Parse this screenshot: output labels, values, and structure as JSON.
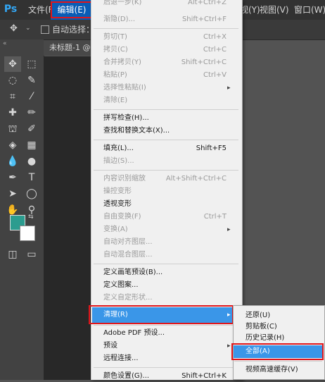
{
  "colors": {
    "accent": "#3a96e8",
    "highlight_border": "#e0161b",
    "menubar": "#323232",
    "foreground": "#2b9c8f",
    "background_color": "#ffffff"
  },
  "menubar": {
    "logo": "Ps",
    "items": [
      {
        "label": "文件(F)"
      },
      {
        "label": "编辑(E)"
      },
      {
        "label": "视(Y)"
      },
      {
        "label": "视图(V)"
      },
      {
        "label": "窗口(W)"
      }
    ]
  },
  "options_bar": {
    "auto_select": "自动选择："
  },
  "document": {
    "tab_title": "未标题-1 @"
  },
  "edit_menu": {
    "items": [
      {
        "label": "后退一步(K)",
        "shortcut": "Alt+Ctrl+Z",
        "enabled": false
      },
      {
        "label": "渐隐(D)...",
        "shortcut": "Shift+Ctrl+F",
        "enabled": false
      },
      {
        "label": "剪切(T)",
        "shortcut": "Ctrl+X",
        "enabled": false
      },
      {
        "label": "拷贝(C)",
        "shortcut": "Ctrl+C",
        "enabled": false
      },
      {
        "label": "合并拷贝(Y)",
        "shortcut": "Shift+Ctrl+C",
        "enabled": false
      },
      {
        "label": "粘贴(P)",
        "shortcut": "Ctrl+V",
        "enabled": false
      },
      {
        "label": "选择性粘贴(I)",
        "shortcut": "",
        "enabled": false,
        "submenu": true
      },
      {
        "label": "清除(E)",
        "shortcut": "",
        "enabled": false
      },
      {
        "label": "拼写检查(H)...",
        "shortcut": "",
        "enabled": true
      },
      {
        "label": "查找和替换文本(X)...",
        "shortcut": "",
        "enabled": true
      },
      {
        "label": "填充(L)...",
        "shortcut": "Shift+F5",
        "enabled": true
      },
      {
        "label": "描边(S)...",
        "shortcut": "",
        "enabled": false
      },
      {
        "label": "内容识别缩放",
        "shortcut": "Alt+Shift+Ctrl+C",
        "enabled": false
      },
      {
        "label": "操控变形",
        "shortcut": "",
        "enabled": false
      },
      {
        "label": "透视变形",
        "shortcut": "",
        "enabled": true
      },
      {
        "label": "自由变换(F)",
        "shortcut": "Ctrl+T",
        "enabled": false
      },
      {
        "label": "变换(A)",
        "shortcut": "",
        "enabled": false,
        "submenu": true
      },
      {
        "label": "自动对齐图层...",
        "shortcut": "",
        "enabled": false
      },
      {
        "label": "自动混合图层...",
        "shortcut": "",
        "enabled": false
      },
      {
        "label": "定义画笔预设(B)...",
        "shortcut": "",
        "enabled": true
      },
      {
        "label": "定义图案...",
        "shortcut": "",
        "enabled": true
      },
      {
        "label": "定义自定形状...",
        "shortcut": "",
        "enabled": false
      },
      {
        "label": "清理(R)",
        "shortcut": "",
        "enabled": true,
        "submenu": true,
        "highlighted": true
      },
      {
        "label": "Adobe PDF 预设...",
        "shortcut": "",
        "enabled": true
      },
      {
        "label": "预设",
        "shortcut": "",
        "enabled": true,
        "submenu": true
      },
      {
        "label": "远程连接...",
        "shortcut": "",
        "enabled": true
      },
      {
        "label": "颜色设置(G)...",
        "shortcut": "Shift+Ctrl+K",
        "enabled": true
      }
    ]
  },
  "purge_submenu": {
    "items": [
      {
        "label": "还原(U)",
        "enabled": true
      },
      {
        "label": "剪贴板(C)",
        "enabled": true
      },
      {
        "label": "历史记录(H)",
        "enabled": true
      },
      {
        "label": "全部(A)",
        "enabled": true,
        "highlighted": true
      },
      {
        "label": "视频高速缓存(V)",
        "enabled": true
      }
    ]
  }
}
